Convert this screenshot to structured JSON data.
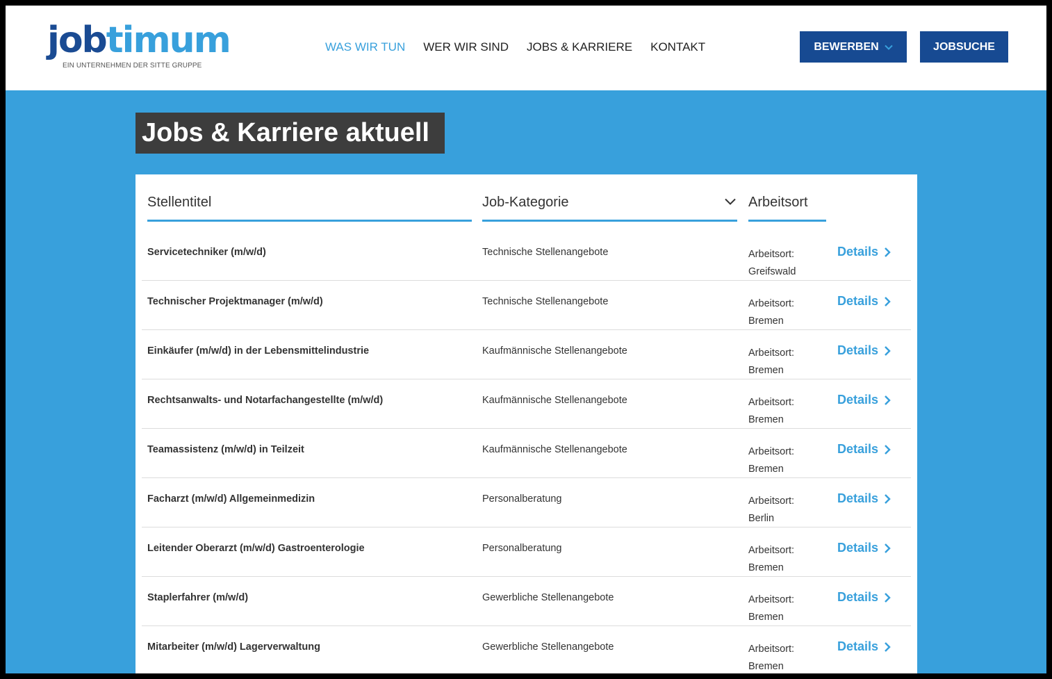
{
  "header": {
    "logo_part1": "job",
    "logo_part2": "timum",
    "logo_subtitle": "EIN UNTERNEHMEN DER SITTE GRUPPE",
    "nav": [
      {
        "label": "WAS WIR TUN",
        "active": true
      },
      {
        "label": "WER WIR SIND",
        "active": false
      },
      {
        "label": "JOBS & KARRIERE",
        "active": false
      },
      {
        "label": "KONTAKT",
        "active": false
      }
    ],
    "apply_label": "BEWERBEN",
    "search_label": "JOBSUCHE"
  },
  "page_title": "Jobs & Karriere aktuell",
  "filters": {
    "title_placeholder": "Stellentitel",
    "category_label": "Job-Kategorie",
    "location_placeholder": "Arbeitsort"
  },
  "location_prefix": "Arbeitsort:",
  "details_label": "Details",
  "jobs": [
    {
      "title": "Servicetechniker (m/w/d)",
      "category": "Technische Stellenangebote",
      "location": "Greifswald"
    },
    {
      "title": "Technischer Projektmanager (m/w/d)",
      "category": "Technische Stellenangebote",
      "location": "Bremen"
    },
    {
      "title": "Einkäufer (m/w/d) in der Lebensmittelindustrie",
      "category": "Kaufmännische Stellenangebote",
      "location": "Bremen"
    },
    {
      "title": "Rechtsanwalts- und Notarfachangestellte (m/w/d)",
      "category": "Kaufmännische Stellenangebote",
      "location": "Bremen"
    },
    {
      "title": "Teamassistenz (m/w/d) in Teilzeit",
      "category": "Kaufmännische Stellenangebote",
      "location": "Bremen"
    },
    {
      "title": "Facharzt (m/w/d) Allgemeinmedizin",
      "category": "Personalberatung",
      "location": "Berlin"
    },
    {
      "title": "Leitender Oberarzt (m/w/d) Gastroenterologie",
      "category": "Personalberatung",
      "location": "Bremen"
    },
    {
      "title": "Staplerfahrer (m/w/d)",
      "category": "Gewerbliche Stellenangebote",
      "location": "Bremen"
    },
    {
      "title": "Mitarbeiter (m/w/d) Lagerverwaltung",
      "category": "Gewerbliche Stellenangebote",
      "location": "Bremen"
    }
  ],
  "colors": {
    "brand_dark": "#174a92",
    "brand_light": "#38a0dc",
    "title_bg": "#3d3d3d"
  }
}
